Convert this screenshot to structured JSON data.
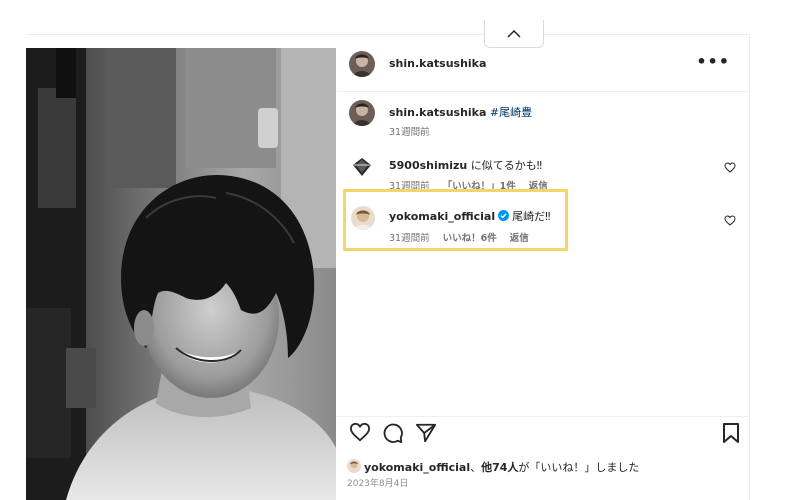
{
  "post": {
    "author": {
      "username": "shin.katsushika"
    },
    "more_label": "•••",
    "caption": {
      "username": "shin.katsushika",
      "hashtag": "#尾崎豊",
      "time": "31週間前"
    },
    "comments": [
      {
        "username": "5900shimizu",
        "text": "に似てるかも‼",
        "time": "31週間前",
        "likes": "「いいね！」1件",
        "reply": "返信"
      },
      {
        "username": "yokomaki_official",
        "verified": true,
        "text": "尾崎だ‼",
        "time": "31週間前",
        "likes": "いいね！6件",
        "reply": "返信",
        "highlighted": true
      }
    ],
    "actions": {
      "like": "heart-icon",
      "comment": "comment-icon",
      "share": "share-icon",
      "save": "bookmark-icon"
    },
    "likes_summary": {
      "user": "yokomaki_official",
      "sep": "、",
      "others": "他74人",
      "suffix": "が「いいね！」しました"
    },
    "date": "2023年8月4日"
  },
  "colors": {
    "highlight": "#f3d56a",
    "link": "#00376b",
    "verified": "#0095f6",
    "muted": "#737373"
  },
  "collapse_button": "chevron-up-icon"
}
